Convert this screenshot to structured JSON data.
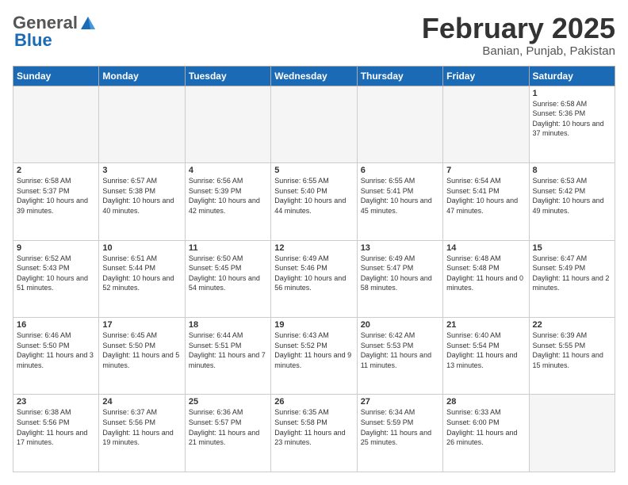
{
  "header": {
    "logo_general": "General",
    "logo_blue": "Blue",
    "month_title": "February 2025",
    "location": "Banian, Punjab, Pakistan"
  },
  "weekdays": [
    "Sunday",
    "Monday",
    "Tuesday",
    "Wednesday",
    "Thursday",
    "Friday",
    "Saturday"
  ],
  "weeks": [
    [
      {
        "day": "",
        "empty": true
      },
      {
        "day": "",
        "empty": true
      },
      {
        "day": "",
        "empty": true
      },
      {
        "day": "",
        "empty": true
      },
      {
        "day": "",
        "empty": true
      },
      {
        "day": "",
        "empty": true
      },
      {
        "day": "1",
        "sunrise": "6:58 AM",
        "sunset": "5:36 PM",
        "daylight": "10 hours and 37 minutes."
      }
    ],
    [
      {
        "day": "2",
        "sunrise": "6:58 AM",
        "sunset": "5:37 PM",
        "daylight": "10 hours and 39 minutes."
      },
      {
        "day": "3",
        "sunrise": "6:57 AM",
        "sunset": "5:38 PM",
        "daylight": "10 hours and 40 minutes."
      },
      {
        "day": "4",
        "sunrise": "6:56 AM",
        "sunset": "5:39 PM",
        "daylight": "10 hours and 42 minutes."
      },
      {
        "day": "5",
        "sunrise": "6:55 AM",
        "sunset": "5:40 PM",
        "daylight": "10 hours and 44 minutes."
      },
      {
        "day": "6",
        "sunrise": "6:55 AM",
        "sunset": "5:41 PM",
        "daylight": "10 hours and 45 minutes."
      },
      {
        "day": "7",
        "sunrise": "6:54 AM",
        "sunset": "5:41 PM",
        "daylight": "10 hours and 47 minutes."
      },
      {
        "day": "8",
        "sunrise": "6:53 AM",
        "sunset": "5:42 PM",
        "daylight": "10 hours and 49 minutes."
      }
    ],
    [
      {
        "day": "9",
        "sunrise": "6:52 AM",
        "sunset": "5:43 PM",
        "daylight": "10 hours and 51 minutes."
      },
      {
        "day": "10",
        "sunrise": "6:51 AM",
        "sunset": "5:44 PM",
        "daylight": "10 hours and 52 minutes."
      },
      {
        "day": "11",
        "sunrise": "6:50 AM",
        "sunset": "5:45 PM",
        "daylight": "10 hours and 54 minutes."
      },
      {
        "day": "12",
        "sunrise": "6:49 AM",
        "sunset": "5:46 PM",
        "daylight": "10 hours and 56 minutes."
      },
      {
        "day": "13",
        "sunrise": "6:49 AM",
        "sunset": "5:47 PM",
        "daylight": "10 hours and 58 minutes."
      },
      {
        "day": "14",
        "sunrise": "6:48 AM",
        "sunset": "5:48 PM",
        "daylight": "11 hours and 0 minutes."
      },
      {
        "day": "15",
        "sunrise": "6:47 AM",
        "sunset": "5:49 PM",
        "daylight": "11 hours and 2 minutes."
      }
    ],
    [
      {
        "day": "16",
        "sunrise": "6:46 AM",
        "sunset": "5:50 PM",
        "daylight": "11 hours and 3 minutes."
      },
      {
        "day": "17",
        "sunrise": "6:45 AM",
        "sunset": "5:50 PM",
        "daylight": "11 hours and 5 minutes."
      },
      {
        "day": "18",
        "sunrise": "6:44 AM",
        "sunset": "5:51 PM",
        "daylight": "11 hours and 7 minutes."
      },
      {
        "day": "19",
        "sunrise": "6:43 AM",
        "sunset": "5:52 PM",
        "daylight": "11 hours and 9 minutes."
      },
      {
        "day": "20",
        "sunrise": "6:42 AM",
        "sunset": "5:53 PM",
        "daylight": "11 hours and 11 minutes."
      },
      {
        "day": "21",
        "sunrise": "6:40 AM",
        "sunset": "5:54 PM",
        "daylight": "11 hours and 13 minutes."
      },
      {
        "day": "22",
        "sunrise": "6:39 AM",
        "sunset": "5:55 PM",
        "daylight": "11 hours and 15 minutes."
      }
    ],
    [
      {
        "day": "23",
        "sunrise": "6:38 AM",
        "sunset": "5:56 PM",
        "daylight": "11 hours and 17 minutes."
      },
      {
        "day": "24",
        "sunrise": "6:37 AM",
        "sunset": "5:56 PM",
        "daylight": "11 hours and 19 minutes."
      },
      {
        "day": "25",
        "sunrise": "6:36 AM",
        "sunset": "5:57 PM",
        "daylight": "11 hours and 21 minutes."
      },
      {
        "day": "26",
        "sunrise": "6:35 AM",
        "sunset": "5:58 PM",
        "daylight": "11 hours and 23 minutes."
      },
      {
        "day": "27",
        "sunrise": "6:34 AM",
        "sunset": "5:59 PM",
        "daylight": "11 hours and 25 minutes."
      },
      {
        "day": "28",
        "sunrise": "6:33 AM",
        "sunset": "6:00 PM",
        "daylight": "11 hours and 26 minutes."
      },
      {
        "day": "",
        "empty": true
      }
    ]
  ]
}
